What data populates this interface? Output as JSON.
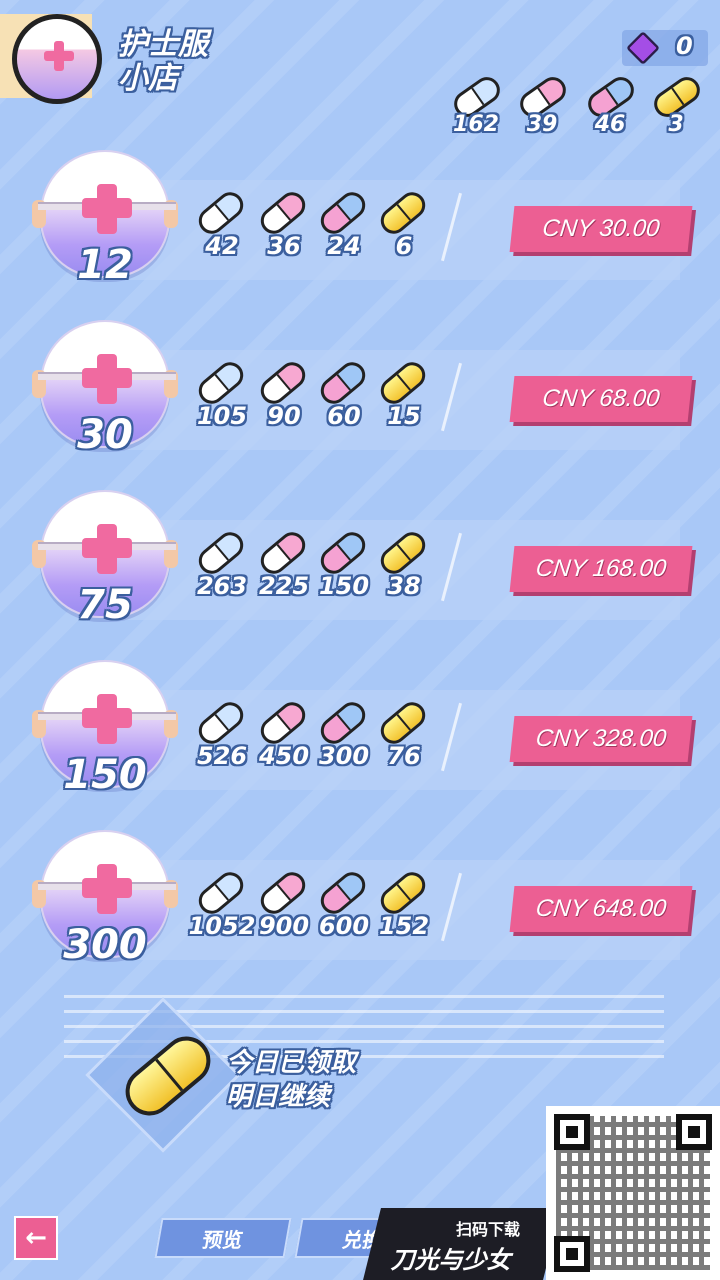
{
  "header": {
    "title": "护士服\n小店",
    "gem_count": "0"
  },
  "totals": [
    {
      "type": "white",
      "count": "162"
    },
    {
      "type": "pink",
      "count": "39"
    },
    {
      "type": "mix",
      "count": "46"
    },
    {
      "type": "gold",
      "count": "3"
    }
  ],
  "packs": [
    {
      "kit_count": "12",
      "pills": [
        "42",
        "36",
        "24",
        "6"
      ],
      "price": "CNY 30.00"
    },
    {
      "kit_count": "30",
      "pills": [
        "105",
        "90",
        "60",
        "15"
      ],
      "price": "CNY 68.00"
    },
    {
      "kit_count": "75",
      "pills": [
        "263",
        "225",
        "150",
        "38"
      ],
      "price": "CNY 168.00"
    },
    {
      "kit_count": "150",
      "pills": [
        "526",
        "450",
        "300",
        "76"
      ],
      "price": "CNY 328.00"
    },
    {
      "kit_count": "300",
      "pills": [
        "1052",
        "900",
        "600",
        "152"
      ],
      "price": "CNY 648.00"
    }
  ],
  "daily": {
    "line1": "今日已领取",
    "line2": "明日继续"
  },
  "bottom": {
    "back_icon": "←",
    "preview_label": "预览",
    "exchange_label": "兑换",
    "promo_line1": "扫码下载",
    "promo_line2": "刀光与少女"
  },
  "colors": {
    "background": "#a9c8f7",
    "price_button": "#ec5f93",
    "gem": "#a44ee6"
  }
}
